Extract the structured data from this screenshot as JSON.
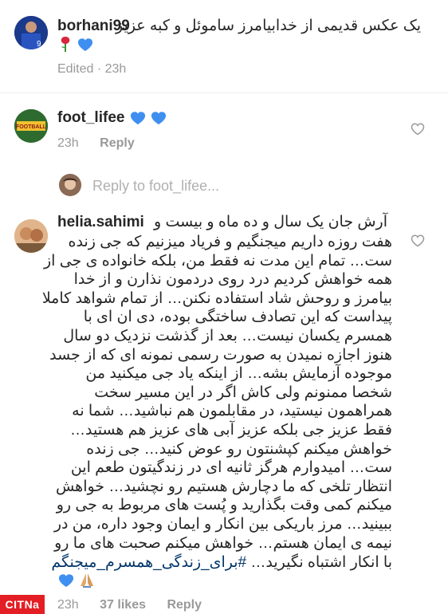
{
  "comments": [
    {
      "username": "borhani99",
      "text": "یک عکس قدیمی از خدابیامرز ساموئل و کبه عزیز",
      "emojis": [
        "rose",
        "blue-heart"
      ],
      "meta": {
        "edited": "Edited",
        "time": "23h"
      }
    },
    {
      "username": "foot_lifee",
      "emojis": [
        "blue-heart",
        "blue-heart"
      ],
      "meta": {
        "time": "23h",
        "reply": "Reply"
      }
    },
    {
      "username": "helia.sahimi",
      "lines": [
        "آرش جان یک سال و ده ماه و بیست و",
        "هفت روزه داریم میجنگیم و فریاد میزنیم که جی زنده",
        "ست… تمام این مدت نه فقط من، بلکه خانواده ی جی از",
        "همه خواهش کردیم درد روی دردمون نذارن و از خدا",
        "بیامرز و روحش شاد استفاده نکنن… از تمام شواهد کاملا",
        "پیداست که این تصادف ساختگی بوده، دی ان ای با",
        "همسرم یکسان نیست… بعد از گذشت نزدیک دو سال",
        "هنوز اجازه نمیدن به صورت رسمی نمونه ای که از جسد",
        "موجوده آزمایش بشه… از اینکه یاد جی میکنید من",
        "شخصا ممنونم ولی کاش اگر در این مسیر سخت",
        "همراهمون نیستید، در مقابلمون هم نباشید… شما نه",
        "فقط عزیز جی بلکه عزیز آبی های عزیز هم هستید…",
        "خواهش میکنم کپشنتون رو عوض کنید… جی زنده",
        "ست… امیدوارم هرگز ثانیه ای در زندگیتون طعم این",
        "انتظار تلخی که ما دچارش هستیم رو نچشید… خواهش",
        "میکنم کمی وقت بگذارید و پُست های مربوط به جی رو",
        "ببینید… مرز باریکی بین انکار و ایمان وجود داره، من در",
        "نیمه ی ایمان هستم… خواهش میکنم صحبت های ما رو"
      ],
      "last_line_prefix": "با انکار اشتباه نگیرید…",
      "hashtag": "#برای_زندگی_همسرم_میجنگم",
      "emojis": [
        "blue-heart",
        "praying-hands"
      ],
      "meta": {
        "time": "23h",
        "likes": "37 likes",
        "reply": "Reply"
      }
    }
  ],
  "reply_prompt": "Reply to foot_lifee...",
  "icons": {
    "heart": "heart-outline-icon",
    "like_color": "#999999",
    "blue_heart": "#3f8ff0"
  },
  "watermark": "CITNa"
}
